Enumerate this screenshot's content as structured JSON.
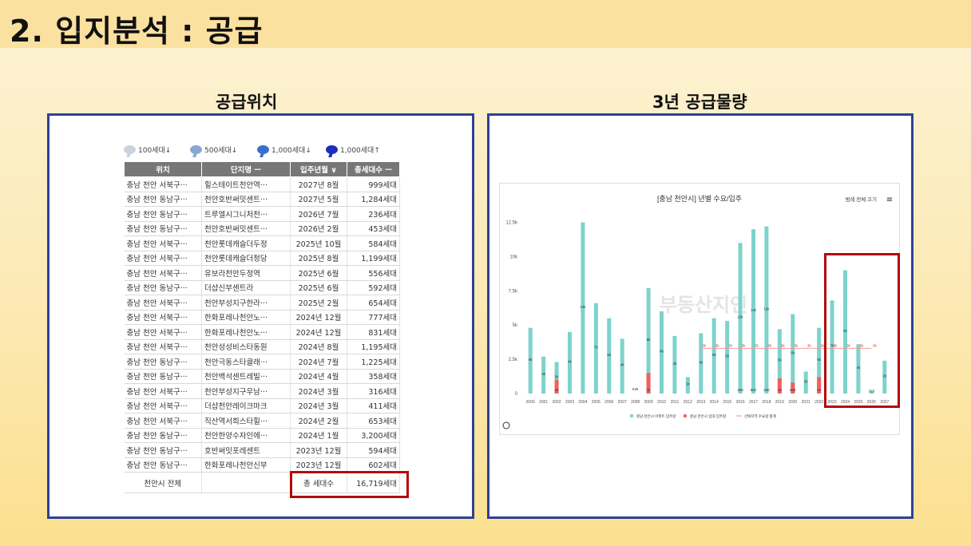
{
  "slide": {
    "title": "2. 입지분석 : 공급",
    "left_caption": "공급위치",
    "right_caption": "3년 공급물량"
  },
  "legend": [
    {
      "label": "100세대↓",
      "color": "#c9d3df"
    },
    {
      "label": "500세대↓",
      "color": "#8aa6d2"
    },
    {
      "label": "1,000세대↓",
      "color": "#3a6fd0"
    },
    {
      "label": "1,000세대↑",
      "color": "#1c2fb8"
    }
  ],
  "table": {
    "headers": [
      "위치",
      "단지명 ㅡ",
      "입주년월 ∨",
      "총세대수 ㅡ"
    ],
    "rows": [
      [
        "충남 천안 서북구···",
        "힐스테이트천안역···",
        "2027년 8월",
        "999세대"
      ],
      [
        "충남 천안 동남구···",
        "천안호반써밋센트···",
        "2027년 5월",
        "1,284세대"
      ],
      [
        "충남 천안 동남구···",
        "트루엘시그니처천···",
        "2026년 7월",
        "236세대"
      ],
      [
        "충남 천안 동남구···",
        "천안호반써밋센트···",
        "2026년 2월",
        "453세대"
      ],
      [
        "충남 천안 서북구···",
        "천안롯데캐슬더두정",
        "2025년 10월",
        "584세대"
      ],
      [
        "충남 천안 서북구···",
        "천안롯데캐슬더청당",
        "2025년 8월",
        "1,199세대"
      ],
      [
        "충남 천안 서북구···",
        "유보라천안두정역",
        "2025년 6월",
        "556세대"
      ],
      [
        "충남 천안 동남구···",
        "더샵신부센트라",
        "2025년 6월",
        "592세대"
      ],
      [
        "충남 천안 서북구···",
        "천안부성지구한라···",
        "2025년 2월",
        "654세대"
      ],
      [
        "충남 천안 서북구···",
        "한화포레나천안노···",
        "2024년 12월",
        "777세대"
      ],
      [
        "충남 천안 서북구···",
        "한화포레나천안노···",
        "2024년 12월",
        "831세대"
      ],
      [
        "충남 천안 서북구···",
        "천안성성비스타동원",
        "2024년 8월",
        "1,195세대"
      ],
      [
        "충남 천안 동남구···",
        "천안극동스타클래···",
        "2024년 7월",
        "1,225세대"
      ],
      [
        "충남 천안 동남구···",
        "천안백석센트레빌···",
        "2024년 4월",
        "358세대"
      ],
      [
        "충남 천안 서북구···",
        "천안부성지구우남···",
        "2024년 3월",
        "316세대"
      ],
      [
        "충남 천안 서북구···",
        "더샵천안레이크마크",
        "2024년 3월",
        "411세대"
      ],
      [
        "충남 천안 서북구···",
        "직산역서희스타힐···",
        "2024년 2월",
        "653세대"
      ],
      [
        "충남 천안 동남구···",
        "천안한양수자인에···",
        "2024년 1월",
        "3,200세대"
      ],
      [
        "충남 천안 동남구···",
        "호반써밋포레센트",
        "2023년 12월",
        "594세대"
      ],
      [
        "충남 천안 동남구···",
        "한화포레나천안신부",
        "2023년 12월",
        "602세대"
      ]
    ],
    "total": {
      "label": "천안시 전체",
      "caption": "총 세대수",
      "value": "16,719세대"
    }
  },
  "chart_data": {
    "type": "bar",
    "title": "[충남 천안시] 년별 수요/입주",
    "toggle_label": "범례 전체 끄기",
    "watermark": "부동산지인",
    "categories": [
      "2000",
      "2001",
      "2002",
      "2003",
      "2004",
      "2005",
      "2006",
      "2007",
      "2008",
      "2009",
      "2010",
      "2011",
      "2012",
      "2013",
      "2014",
      "2015",
      "2016",
      "2017",
      "2018",
      "2019",
      "2020",
      "2021",
      "2022",
      "2023",
      "2024",
      "2025",
      "2026",
      "2027"
    ],
    "series": [
      {
        "name": "충남 천안시 아파트 입주량",
        "color": "#7dd3cc",
        "values": [
          4800,
          2700,
          2300,
          4500,
          12500,
          6600,
          5500,
          4000,
          0,
          7700,
          6000,
          4200,
          1200,
          4400,
          5500,
          5300,
          11000,
          12000,
          12200,
          4700,
          5800,
          1600,
          4800,
          6800,
          9000,
          3600,
          200,
          2400
        ]
      },
      {
        "name": "충남 천안시 임대 입주량",
        "color": "#f25f5c",
        "values": [
          0,
          0,
          1000,
          0,
          0,
          0,
          0,
          0,
          0,
          1500,
          0,
          0,
          0,
          0,
          0,
          0,
          0,
          0,
          0,
          1100,
          800,
          0,
          1200,
          0,
          0,
          0,
          0,
          0
        ]
      },
      {
        "name": "선택지역 수요량 합계",
        "color": "#f2a0a0",
        "values": [
          null,
          null,
          null,
          null,
          null,
          null,
          null,
          null,
          null,
          null,
          null,
          null,
          null,
          3300,
          3300,
          3300,
          3300,
          3300,
          3300,
          3300,
          3300,
          3300,
          3300,
          3300,
          3300,
          3300,
          3300,
          null
        ]
      }
    ],
    "bar_labels": [
      "5k",
      "3k",
      "2k",
      "4k",
      "13k",
      "7k",
      "6k",
      "4k",
      "536",
      "8k",
      "6k",
      "4k",
      "1k",
      "4k",
      "5k",
      "5k",
      "11k",
      "12k",
      "12k",
      "5k",
      "6k",
      "2k",
      "5k",
      "7k",
      "9k",
      "4k",
      "715",
      "2k"
    ],
    "demand_labels": [
      "3k",
      "3k",
      "3k",
      "3k",
      "3k",
      "3k",
      "3k",
      "3k",
      "3k",
      "3k",
      "3k",
      "3k",
      "3k",
      "3k"
    ],
    "stack_labels": [
      "",
      "",
      "1k",
      "",
      "",
      "",
      "",
      "",
      "",
      "1k",
      "",
      "",
      "",
      "",
      "",
      "",
      "305",
      "562",
      "450",
      "1k",
      "804",
      "",
      "1k",
      "",
      "",
      "",
      "",
      ""
    ],
    "yticks": [
      0,
      2500,
      5000,
      7500,
      10000,
      12500
    ],
    "ytick_labels": [
      "0",
      "2.5k",
      "5k",
      "7.5k",
      "10k",
      "12.5k"
    ],
    "ylim": [
      0,
      13000
    ],
    "legend": "bottom",
    "grid": false
  }
}
